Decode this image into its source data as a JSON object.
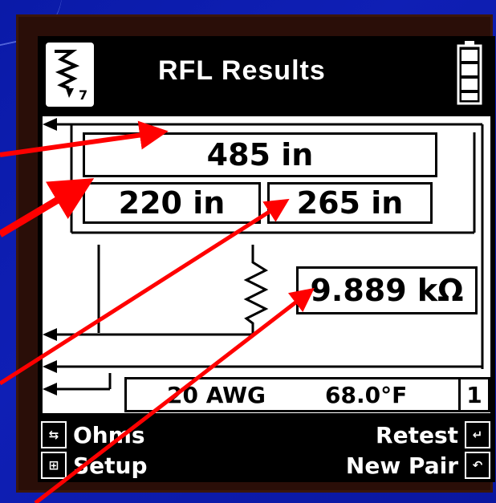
{
  "header": {
    "title": "RFL Results",
    "mode_icon": "rfl-mode-icon",
    "battery_icon": "battery-icon"
  },
  "results": {
    "total_distance": "485 in",
    "distance_to_fault_near": "220 in",
    "distance_to_fault_far": "265 in",
    "fault_resistance": "9.889 kΩ"
  },
  "status_bar": {
    "wire_gauge": "20 AWG",
    "temperature": "68.0°F",
    "pair_number": "1"
  },
  "softkeys": {
    "ohms": "Ohms",
    "setup": "Setup",
    "retest": "Retest",
    "new_pair": "New Pair"
  },
  "colors": {
    "background": "#0f1fb5",
    "arrow": "#ff0000",
    "screen_white": "#ffffff",
    "screen_black": "#000000"
  }
}
